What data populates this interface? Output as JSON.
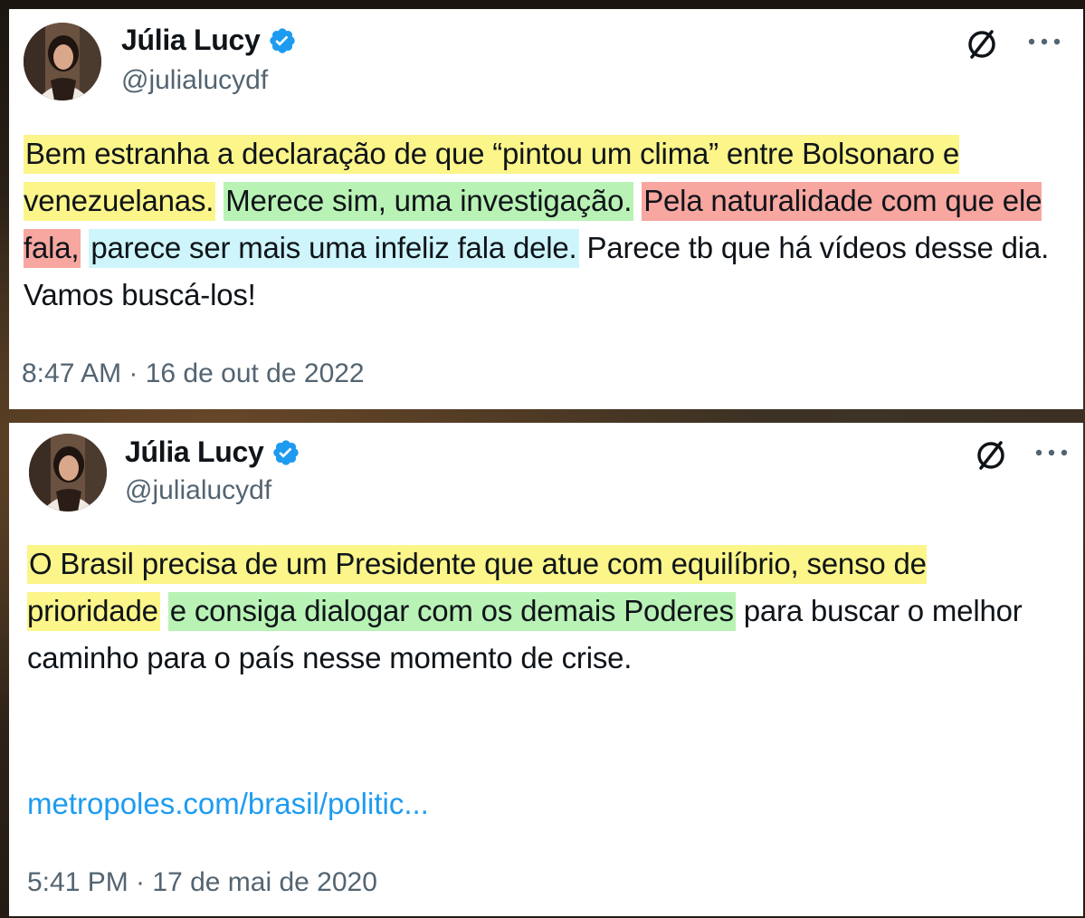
{
  "tweets": [
    {
      "author": {
        "name": "Júlia Lucy",
        "handle": "@julialucydf"
      },
      "segments": [
        {
          "text": "Bem estranha a declaração de que “pintou um clima” entre Bolsonaro e venezuelanas.",
          "highlight": "yellow"
        },
        {
          "text": " ",
          "highlight": "none"
        },
        {
          "text": "Merece sim, uma investigação.",
          "highlight": "green"
        },
        {
          "text": " ",
          "highlight": "none"
        },
        {
          "text": "Pela naturalidade com que ele fala,",
          "highlight": "red"
        },
        {
          "text": " ",
          "highlight": "none"
        },
        {
          "text": "parece ser mais uma infeliz fala dele.",
          "highlight": "cyan"
        },
        {
          "text": " Parece tb que há vídeos desse dia. Vamos buscá-los!",
          "highlight": "none"
        }
      ],
      "timestamp": "8:47 AM · 16 de out de 2022"
    },
    {
      "author": {
        "name": "Júlia Lucy",
        "handle": "@julialucydf"
      },
      "segments": [
        {
          "text": "O Brasil precisa de um Presidente que atue com equilíbrio, senso de prioridade",
          "highlight": "yellow"
        },
        {
          "text": " ",
          "highlight": "none"
        },
        {
          "text": "e consiga dialogar com os demais Poderes",
          "highlight": "green"
        },
        {
          "text": " para buscar o melhor caminho para o país nesse momento de crise.",
          "highlight": "none"
        }
      ],
      "link": "metropoles.com/brasil/politic...",
      "timestamp": "5:41 PM · 17 de mai de 2020"
    }
  ],
  "icons": {
    "verified": "verified-badge-icon",
    "grok": "grok-icon",
    "more": "more-options-icon"
  },
  "colors": {
    "verified_blue": "#1d9bf0",
    "link_blue": "#1d9bf0",
    "highlight_yellow": "#fbf58a",
    "highlight_green": "#b9f2b5",
    "highlight_red": "#f7a6a0",
    "highlight_cyan": "#cdf5fb"
  }
}
